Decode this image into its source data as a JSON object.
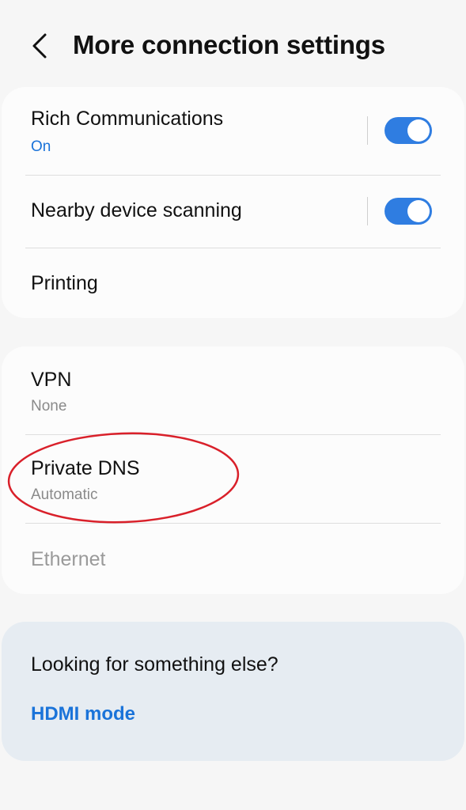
{
  "header": {
    "title": "More connection settings",
    "back_icon": "chevron-left-icon"
  },
  "connectivity_group": {
    "items": [
      {
        "title": "Rich Communications",
        "subtitle": "On",
        "toggle_on": true
      },
      {
        "title": "Nearby device scanning",
        "toggle_on": true
      },
      {
        "title": "Printing"
      }
    ]
  },
  "network_group": {
    "items": [
      {
        "title": "VPN",
        "subtitle": "None"
      },
      {
        "title": "Private DNS",
        "subtitle": "Automatic"
      },
      {
        "title": "Ethernet",
        "disabled": true
      }
    ]
  },
  "suggestions": {
    "heading": "Looking for something else?",
    "link": "HDMI mode"
  },
  "colors": {
    "accent": "#2f7de1",
    "link": "#1a73d9",
    "annotation": "#d9202a",
    "background": "#f6f6f6"
  }
}
